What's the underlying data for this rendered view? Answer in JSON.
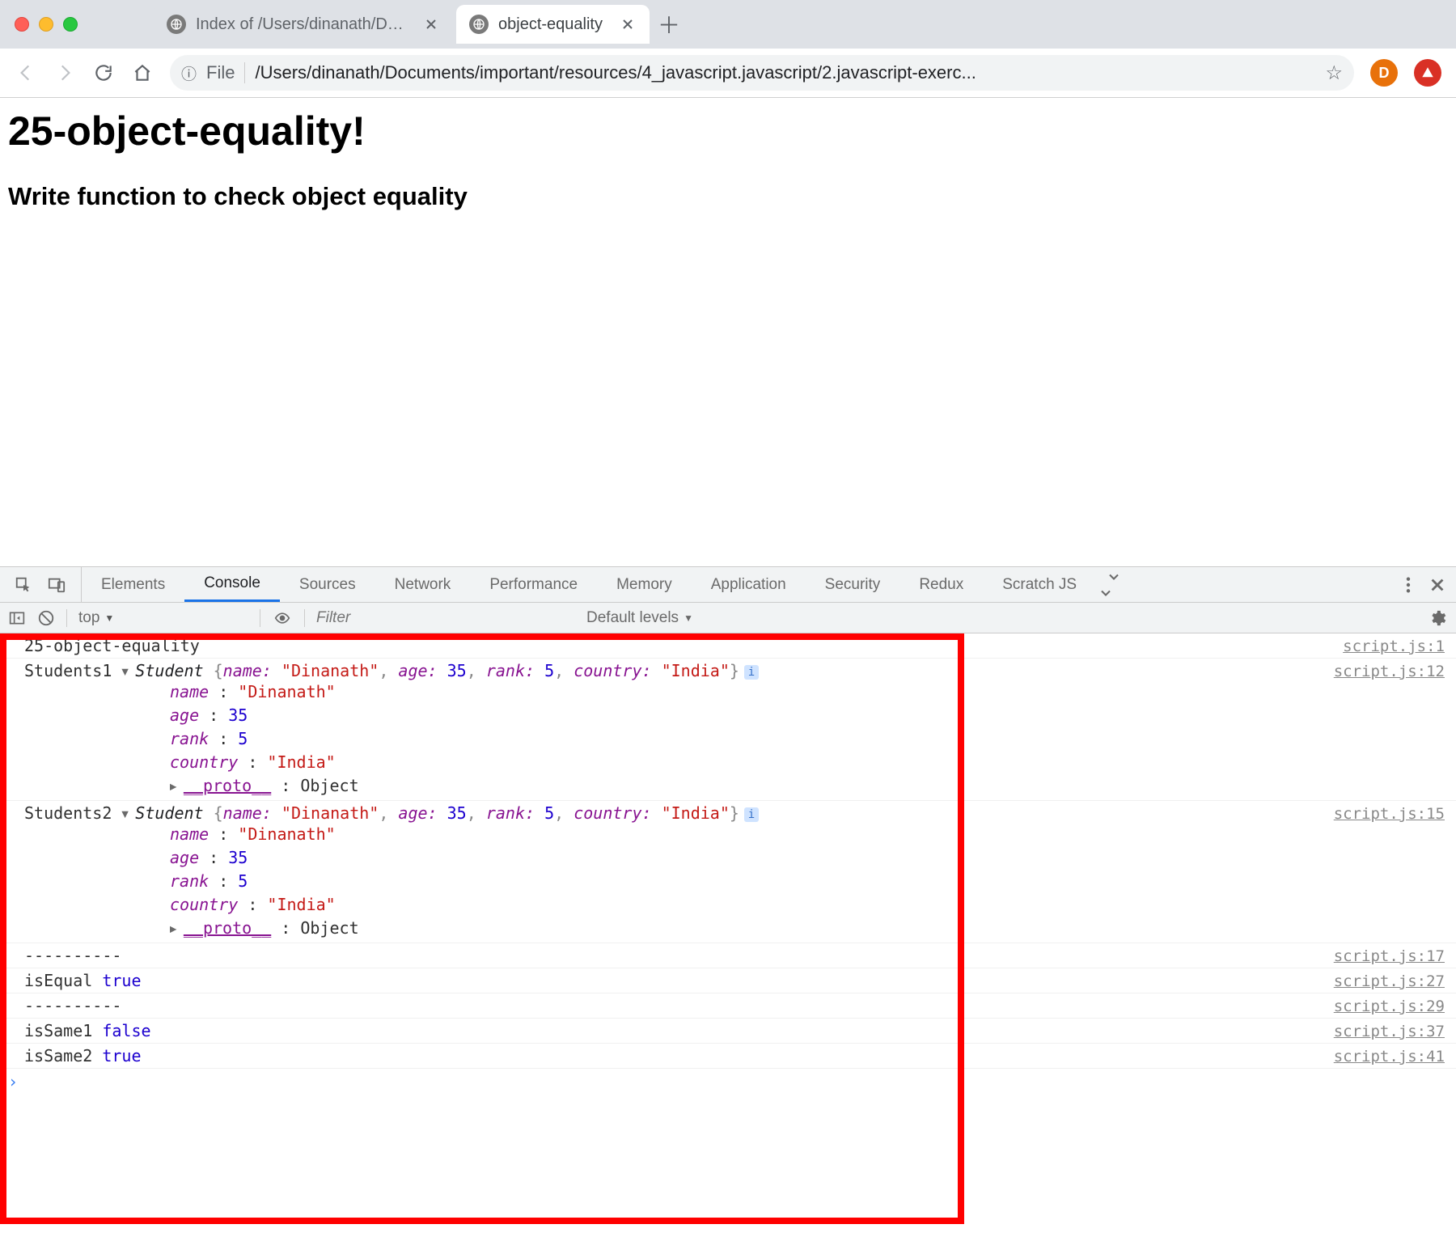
{
  "chrome": {
    "tabs": [
      {
        "title": "Index of /Users/dinanath/Docum",
        "active": false
      },
      {
        "title": "object-equality",
        "active": true
      }
    ],
    "url_prefix_label": "File",
    "url_path": "/Users/dinanath/Documents/important/resources/4_javascript.javascript/2.javascript-exerc...",
    "avatar_initial": "D"
  },
  "page": {
    "h1": "25-object-equality!",
    "h2": "Write function to check object equality"
  },
  "devtools": {
    "tabs": [
      "Elements",
      "Console",
      "Sources",
      "Network",
      "Performance",
      "Memory",
      "Application",
      "Security",
      "Redux",
      "Scratch JS"
    ],
    "active_tab": "Console",
    "subbar": {
      "context": "top",
      "filter_placeholder": "Filter",
      "levels_label": "Default levels"
    },
    "logs": [
      {
        "kind": "plain",
        "text": "25-object-equality",
        "src": "script.js:1"
      },
      {
        "kind": "object",
        "label": "Students1",
        "class": "Student",
        "summary_props": [
          {
            "k": "name",
            "v": "\"Dinanath\"",
            "t": "str"
          },
          {
            "k": "age",
            "v": "35",
            "t": "num"
          },
          {
            "k": "rank",
            "v": "5",
            "t": "num"
          },
          {
            "k": "country",
            "v": "\"India\"",
            "t": "str"
          }
        ],
        "detail": [
          {
            "k": "name",
            "v": "\"Dinanath\"",
            "t": "str"
          },
          {
            "k": "age",
            "v": "35",
            "t": "num"
          },
          {
            "k": "rank",
            "v": "5",
            "t": "num"
          },
          {
            "k": "country",
            "v": "\"India\"",
            "t": "str"
          },
          {
            "k": "__proto__",
            "v": "Object",
            "t": "proto"
          }
        ],
        "src": "script.js:12"
      },
      {
        "kind": "object",
        "label": "Students2",
        "class": "Student",
        "summary_props": [
          {
            "k": "name",
            "v": "\"Dinanath\"",
            "t": "str"
          },
          {
            "k": "age",
            "v": "35",
            "t": "num"
          },
          {
            "k": "rank",
            "v": "5",
            "t": "num"
          },
          {
            "k": "country",
            "v": "\"India\"",
            "t": "str"
          }
        ],
        "detail": [
          {
            "k": "name",
            "v": "\"Dinanath\"",
            "t": "str"
          },
          {
            "k": "age",
            "v": "35",
            "t": "num"
          },
          {
            "k": "rank",
            "v": "5",
            "t": "num"
          },
          {
            "k": "country",
            "v": "\"India\"",
            "t": "str"
          },
          {
            "k": "__proto__",
            "v": "Object",
            "t": "proto"
          }
        ],
        "src": "script.js:15"
      },
      {
        "kind": "plain",
        "text": "----------",
        "src": "script.js:17"
      },
      {
        "kind": "kv",
        "key": "isEqual",
        "val": "true",
        "t": "bool",
        "src": "script.js:27"
      },
      {
        "kind": "plain",
        "text": "----------",
        "src": "script.js:29"
      },
      {
        "kind": "kv",
        "key": "isSame1",
        "val": "false",
        "t": "bool",
        "src": "script.js:37"
      },
      {
        "kind": "kv",
        "key": "isSame2",
        "val": "true",
        "t": "bool",
        "src": "script.js:41"
      }
    ]
  }
}
